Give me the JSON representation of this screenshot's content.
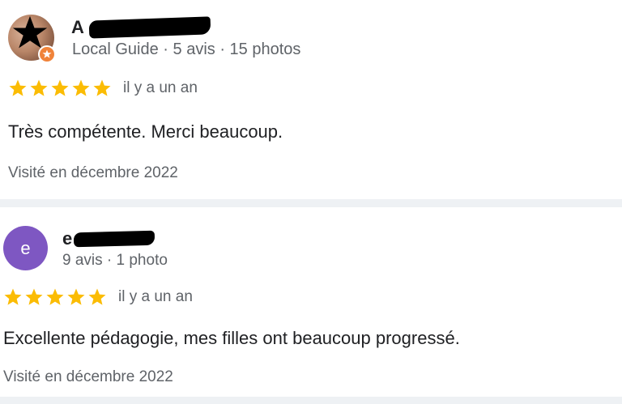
{
  "reviews": [
    {
      "author_visible": "A",
      "author_redacted": true,
      "avatar_type": "photo",
      "badge": "local-guide-icon",
      "meta": "Local Guide · 5 avis · 15 photos",
      "rating": 5,
      "rating_max": 5,
      "time": "il y a un an",
      "text": "Très compétente. Merci beaucoup.",
      "visited": "Visité en décembre 2022"
    },
    {
      "author_visible": "e",
      "author_redacted": true,
      "avatar_type": "letter",
      "avatar_letter": "e",
      "avatar_color": "#7e57c2",
      "meta": "9 avis · 1 photo",
      "rating": 5,
      "rating_max": 5,
      "time": "il y a un an",
      "text": "Excellente pédagogie, mes filles ont beaucoup progressé.",
      "visited": "Visité en décembre 2022"
    }
  ],
  "colors": {
    "star": "#fbbc04",
    "secondary_text": "#5f6368",
    "primary_text": "#202124",
    "divider": "#eef1f4",
    "badge": "#f0833a"
  }
}
